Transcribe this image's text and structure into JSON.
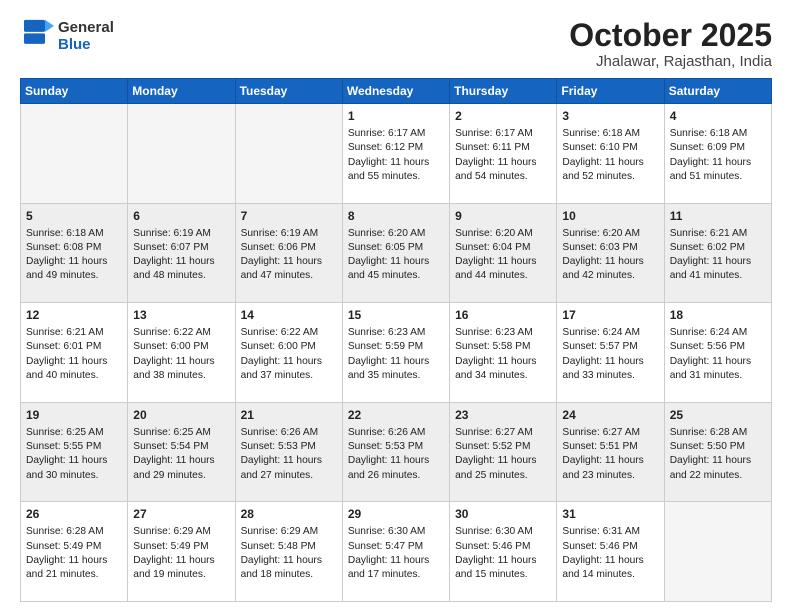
{
  "header": {
    "logo_general": "General",
    "logo_blue": "Blue",
    "month_year": "October 2025",
    "location": "Jhalawar, Rajasthan, India"
  },
  "weekdays": [
    "Sunday",
    "Monday",
    "Tuesday",
    "Wednesday",
    "Thursday",
    "Friday",
    "Saturday"
  ],
  "weeks": [
    [
      {
        "day": "",
        "empty": true
      },
      {
        "day": "",
        "empty": true
      },
      {
        "day": "",
        "empty": true
      },
      {
        "day": "1",
        "sunrise": "6:17 AM",
        "sunset": "6:12 PM",
        "daylight": "11 hours and 55 minutes."
      },
      {
        "day": "2",
        "sunrise": "6:17 AM",
        "sunset": "6:11 PM",
        "daylight": "11 hours and 54 minutes."
      },
      {
        "day": "3",
        "sunrise": "6:18 AM",
        "sunset": "6:10 PM",
        "daylight": "11 hours and 52 minutes."
      },
      {
        "day": "4",
        "sunrise": "6:18 AM",
        "sunset": "6:09 PM",
        "daylight": "11 hours and 51 minutes."
      }
    ],
    [
      {
        "day": "5",
        "sunrise": "6:18 AM",
        "sunset": "6:08 PM",
        "daylight": "11 hours and 49 minutes."
      },
      {
        "day": "6",
        "sunrise": "6:19 AM",
        "sunset": "6:07 PM",
        "daylight": "11 hours and 48 minutes."
      },
      {
        "day": "7",
        "sunrise": "6:19 AM",
        "sunset": "6:06 PM",
        "daylight": "11 hours and 47 minutes."
      },
      {
        "day": "8",
        "sunrise": "6:20 AM",
        "sunset": "6:05 PM",
        "daylight": "11 hours and 45 minutes."
      },
      {
        "day": "9",
        "sunrise": "6:20 AM",
        "sunset": "6:04 PM",
        "daylight": "11 hours and 44 minutes."
      },
      {
        "day": "10",
        "sunrise": "6:20 AM",
        "sunset": "6:03 PM",
        "daylight": "11 hours and 42 minutes."
      },
      {
        "day": "11",
        "sunrise": "6:21 AM",
        "sunset": "6:02 PM",
        "daylight": "11 hours and 41 minutes."
      }
    ],
    [
      {
        "day": "12",
        "sunrise": "6:21 AM",
        "sunset": "6:01 PM",
        "daylight": "11 hours and 40 minutes."
      },
      {
        "day": "13",
        "sunrise": "6:22 AM",
        "sunset": "6:00 PM",
        "daylight": "11 hours and 38 minutes."
      },
      {
        "day": "14",
        "sunrise": "6:22 AM",
        "sunset": "6:00 PM",
        "daylight": "11 hours and 37 minutes."
      },
      {
        "day": "15",
        "sunrise": "6:23 AM",
        "sunset": "5:59 PM",
        "daylight": "11 hours and 35 minutes."
      },
      {
        "day": "16",
        "sunrise": "6:23 AM",
        "sunset": "5:58 PM",
        "daylight": "11 hours and 34 minutes."
      },
      {
        "day": "17",
        "sunrise": "6:24 AM",
        "sunset": "5:57 PM",
        "daylight": "11 hours and 33 minutes."
      },
      {
        "day": "18",
        "sunrise": "6:24 AM",
        "sunset": "5:56 PM",
        "daylight": "11 hours and 31 minutes."
      }
    ],
    [
      {
        "day": "19",
        "sunrise": "6:25 AM",
        "sunset": "5:55 PM",
        "daylight": "11 hours and 30 minutes."
      },
      {
        "day": "20",
        "sunrise": "6:25 AM",
        "sunset": "5:54 PM",
        "daylight": "11 hours and 29 minutes."
      },
      {
        "day": "21",
        "sunrise": "6:26 AM",
        "sunset": "5:53 PM",
        "daylight": "11 hours and 27 minutes."
      },
      {
        "day": "22",
        "sunrise": "6:26 AM",
        "sunset": "5:53 PM",
        "daylight": "11 hours and 26 minutes."
      },
      {
        "day": "23",
        "sunrise": "6:27 AM",
        "sunset": "5:52 PM",
        "daylight": "11 hours and 25 minutes."
      },
      {
        "day": "24",
        "sunrise": "6:27 AM",
        "sunset": "5:51 PM",
        "daylight": "11 hours and 23 minutes."
      },
      {
        "day": "25",
        "sunrise": "6:28 AM",
        "sunset": "5:50 PM",
        "daylight": "11 hours and 22 minutes."
      }
    ],
    [
      {
        "day": "26",
        "sunrise": "6:28 AM",
        "sunset": "5:49 PM",
        "daylight": "11 hours and 21 minutes."
      },
      {
        "day": "27",
        "sunrise": "6:29 AM",
        "sunset": "5:49 PM",
        "daylight": "11 hours and 19 minutes."
      },
      {
        "day": "28",
        "sunrise": "6:29 AM",
        "sunset": "5:48 PM",
        "daylight": "11 hours and 18 minutes."
      },
      {
        "day": "29",
        "sunrise": "6:30 AM",
        "sunset": "5:47 PM",
        "daylight": "11 hours and 17 minutes."
      },
      {
        "day": "30",
        "sunrise": "6:30 AM",
        "sunset": "5:46 PM",
        "daylight": "11 hours and 15 minutes."
      },
      {
        "day": "31",
        "sunrise": "6:31 AM",
        "sunset": "5:46 PM",
        "daylight": "11 hours and 14 minutes."
      },
      {
        "day": "",
        "empty": true
      }
    ]
  ]
}
